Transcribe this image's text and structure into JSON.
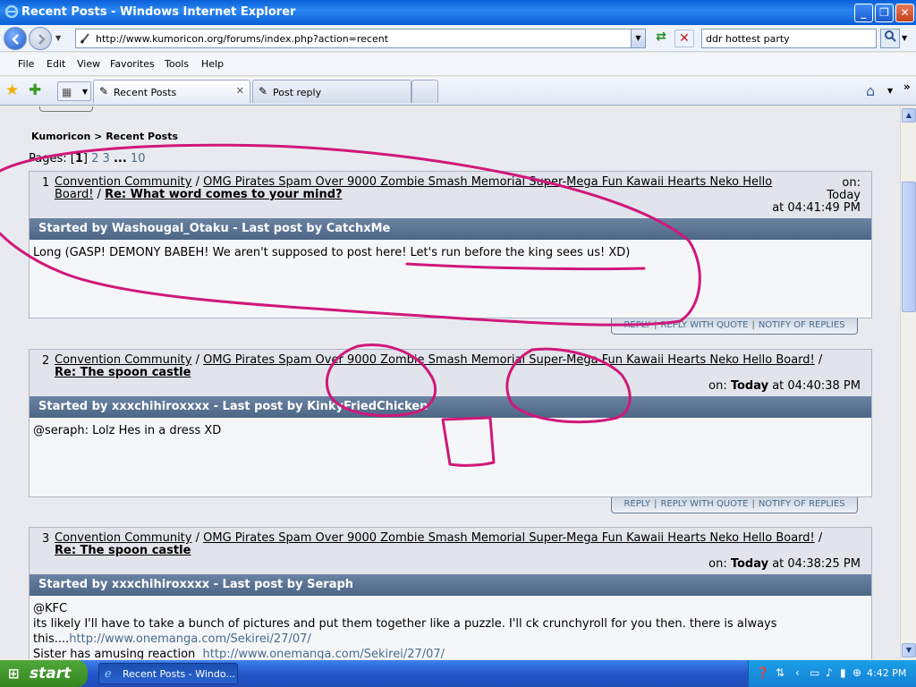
{
  "window": {
    "title": "Recent Posts - Windows Internet Explorer"
  },
  "address_bar": {
    "url": "http://www.kumoricon.org/forums/index.php?action=recent"
  },
  "search": {
    "value": "ddr hottest party"
  },
  "menu": [
    "File",
    "Edit",
    "View",
    "Favorites",
    "Tools",
    "Help"
  ],
  "tabs": [
    {
      "label": "Recent Posts",
      "active": true
    },
    {
      "label": "Post reply",
      "active": false
    }
  ],
  "breadcrumb": {
    "site": "Kumoricon",
    "separator": ">",
    "page": "Recent Posts"
  },
  "pagination": {
    "label": "Pages:",
    "current": "1",
    "pages": [
      "2",
      "3"
    ],
    "ellipsis": "...",
    "last": "10"
  },
  "posts": [
    {
      "num": "1",
      "category": "Convention Community",
      "board": "OMG Pirates Spam Over 9000 Zombie Smash Memorial Super-Mega Fun Kawaii Hearts Neko Hello Board!",
      "topic": "Re: What word comes to your mind?",
      "on_label": "on:",
      "day": "Today",
      "time": "at 04:41:49 PM",
      "started_label": "Started by Washougal_Otaku - Last post by CatchxMe",
      "body": [
        "Long (GASP! DEMONY BABEH! We aren't supposed to post here! Let's run before the king sees us! XD)"
      ]
    },
    {
      "num": "2",
      "category": "Convention Community",
      "board": "OMG Pirates Spam Over 9000 Zombie Smash Memorial Super-Mega Fun Kawaii Hearts Neko Hello Board!",
      "topic": "Re: The spoon castle",
      "on_label": "on:",
      "day": "Today",
      "time": "at 04:40:38 PM",
      "started_label": "Started by xxxchihiroxxxx - Last post by KinkyFriedChicken",
      "body": [
        "@seraph: Lolz Hes in a dress XD"
      ]
    },
    {
      "num": "3",
      "category": "Convention Community",
      "board": "OMG Pirates Spam Over 9000 Zombie Smash Memorial Super-Mega Fun Kawaii Hearts Neko Hello Board!",
      "topic": "Re: The spoon castle",
      "on_label": "on:",
      "day": "Today",
      "time": "at 04:38:25 PM",
      "started_label": "Started by xxxchihiroxxxx - Last post by Seraph",
      "body": [
        "@KFC",
        "its likely I'll have to take a bunch of pictures and put them together like a puzzle.  I'll ck crunchyroll for you then.  there is always",
        "this....",
        "Sister has amusing reaction  "
      ],
      "link": "http://www.onemanga.com/Sekirei/27/07/"
    }
  ],
  "post_actions": {
    "reply": "REPLY",
    "quote": "REPLY WITH QUOTE",
    "notify": "NOTIFY OF REPLIES",
    "separator": "|"
  },
  "taskbar": {
    "start": "start",
    "item": "Recent Posts - Windo...",
    "clock": "4:42 PM"
  },
  "colors": {
    "annotation": "#d0187a",
    "header_bar": "#5a7394",
    "link": "#476c8e"
  }
}
